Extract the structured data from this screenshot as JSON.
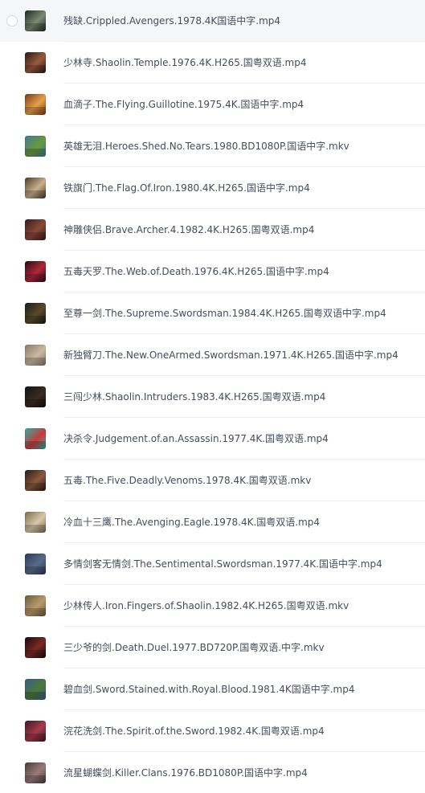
{
  "files": [
    {
      "name": "残缺.Crippled.Avengers.1978.4K国语中字.mp4",
      "selected": true,
      "thumb_colors": [
        "#1f2a22",
        "#7d8a74"
      ]
    },
    {
      "name": "少林寺.Shaolin.Temple.1976.4K.H265.国粤双语.mp4",
      "selected": false,
      "thumb_colors": [
        "#2a1812",
        "#9a5a3c"
      ]
    },
    {
      "name": "血滴子.The.Flying.Guillotine.1975.4K.国语中字.mp4",
      "selected": false,
      "thumb_colors": [
        "#7a3a12",
        "#e6a04a"
      ]
    },
    {
      "name": "英雄无泪.Heroes.Shed.No.Tears.1980.BD1080P.国语中字.mkv",
      "selected": false,
      "thumb_colors": [
        "#3a7a9a",
        "#6a9a3a"
      ]
    },
    {
      "name": "铁旗门.The.Flag.Of.Iron.1980.4K.H265.国语中字.mp4",
      "selected": false,
      "thumb_colors": [
        "#4a3a28",
        "#c9b08a"
      ]
    },
    {
      "name": "神雕侠侣.Brave.Archer.4.1982.4K.H265.国粤双语.mp4",
      "selected": false,
      "thumb_colors": [
        "#3a1a18",
        "#8a4a3a"
      ]
    },
    {
      "name": "五毒天罗.The.Web.of.Death.1976.4K.H265.国语中字.mp4",
      "selected": false,
      "thumb_colors": [
        "#2a0a12",
        "#b0283a"
      ]
    },
    {
      "name": "至尊一剑.The.Supreme.Swordsman.1984.4K.H265.国粤双语中字.mp4",
      "selected": false,
      "thumb_colors": [
        "#1a1a14",
        "#5a4a2a"
      ]
    },
    {
      "name": "新独臂刀.The.New.OneArmed.Swordsman.1971.4K.H265.国语中字.mp4",
      "selected": false,
      "thumb_colors": [
        "#8a7a68",
        "#c8b8a0"
      ]
    },
    {
      "name": "三闯少林.Shaolin.Intruders.1983.4K.H265.国粤双语.mp4",
      "selected": false,
      "thumb_colors": [
        "#121212",
        "#3a2a22"
      ]
    },
    {
      "name": "决杀令.Judgement.of.an.Assassin.1977.4K.国粤双语.mp4",
      "selected": false,
      "thumb_colors": [
        "#2ab0a8",
        "#c83a3a"
      ]
    },
    {
      "name": "五毒.The.Five.Deadly.Venoms.1978.4K.国粤双语.mkv",
      "selected": false,
      "thumb_colors": [
        "#2a1a14",
        "#8a5a40"
      ]
    },
    {
      "name": "冷血十三鹰.The.Avenging.Eagle.1978.4K.国粤双语.mp4",
      "selected": false,
      "thumb_colors": [
        "#7a6a50",
        "#d8c8a8"
      ]
    },
    {
      "name": "多情剑客无情剑.The.Sentimental.Swordsman.1977.4K.国语中字.mp4",
      "selected": false,
      "thumb_colors": [
        "#2a3a5a",
        "#5a6a8a"
      ]
    },
    {
      "name": "少林传人.Iron.Fingers.of.Shaolin.1982.4K.H265.国粤双语.mkv",
      "selected": false,
      "thumb_colors": [
        "#6a5a3a",
        "#b89a6a"
      ]
    },
    {
      "name": "三少爷的剑.Death.Duel.1977.BD720P.国粤双语.中字.mkv",
      "selected": false,
      "thumb_colors": [
        "#1a0a0a",
        "#7a2a22"
      ]
    },
    {
      "name": "碧血剑.Sword.Stained.with.Royal.Blood.1981.4K国语中字.mp4",
      "selected": false,
      "thumb_colors": [
        "#3a5a8a",
        "#4a7a3a"
      ]
    },
    {
      "name": "浣花洗剑.The.Spirit.of.the.Sword.1982.4K.国粤双语.mp4",
      "selected": false,
      "thumb_colors": [
        "#3a1a2a",
        "#a83a4a"
      ]
    },
    {
      "name": "流星蝴蝶剑.Killer.Clans.1976.BD1080P.国语中字.mp4",
      "selected": false,
      "thumb_colors": [
        "#4a3a3a",
        "#9a7a7a"
      ]
    }
  ]
}
